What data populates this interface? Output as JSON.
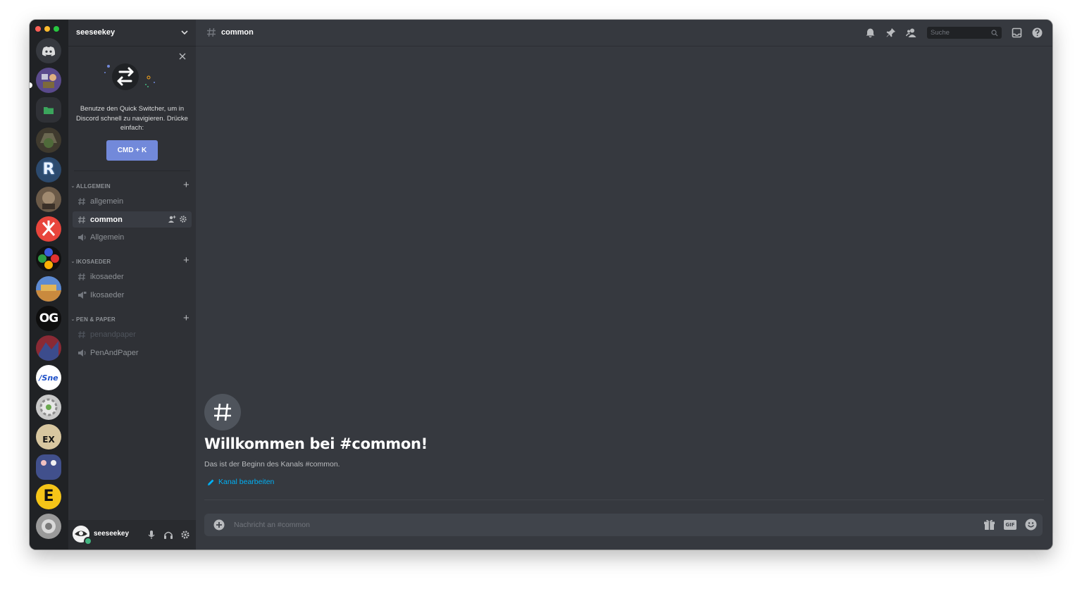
{
  "window": {
    "traffic_lights": [
      "#ff5f57",
      "#febc2e",
      "#28c840"
    ]
  },
  "servers": [
    {
      "name": "home",
      "label": ""
    },
    {
      "name": "server-1",
      "label": ""
    },
    {
      "name": "folder",
      "label": ""
    },
    {
      "name": "server-3",
      "label": ""
    },
    {
      "name": "server-4",
      "label": "R"
    },
    {
      "name": "server-5",
      "label": ""
    },
    {
      "name": "server-6",
      "label": ""
    },
    {
      "name": "server-7",
      "label": ""
    },
    {
      "name": "server-8",
      "label": ""
    },
    {
      "name": "server-9",
      "label": "OG"
    },
    {
      "name": "server-10",
      "label": ""
    },
    {
      "name": "server-11",
      "label": "/Sne"
    },
    {
      "name": "server-12",
      "label": ""
    },
    {
      "name": "server-13",
      "label": "EX"
    },
    {
      "name": "server-14",
      "label": ""
    },
    {
      "name": "server-15",
      "label": "E"
    },
    {
      "name": "server-16",
      "label": ""
    }
  ],
  "guild": {
    "name": "seeseekey"
  },
  "quick_switcher": {
    "text": "Benutze den Quick Switcher, um in Discord schnell zu navigieren. Drücke einfach:",
    "button": "CMD + K"
  },
  "categories": [
    {
      "name": "ALLGEMEIN",
      "channels": [
        {
          "type": "text",
          "name": "allgemein",
          "state": "normal"
        },
        {
          "type": "text",
          "name": "common",
          "state": "active"
        },
        {
          "type": "voice",
          "name": "Allgemein",
          "state": "normal"
        }
      ]
    },
    {
      "name": "IKOSAEDER",
      "channels": [
        {
          "type": "text",
          "name": "ikosaeder",
          "state": "normal"
        },
        {
          "type": "voice",
          "name": "Ikosaeder",
          "state": "normal"
        }
      ]
    },
    {
      "name": "PEN & PAPER",
      "channels": [
        {
          "type": "text",
          "name": "penandpaper",
          "state": "muted"
        },
        {
          "type": "voice",
          "name": "PenAndPaper",
          "state": "normal"
        }
      ]
    }
  ],
  "user": {
    "name": "seeseekey",
    "status": "online"
  },
  "channel_header": {
    "name": "common",
    "search_placeholder": "Suche"
  },
  "welcome": {
    "title": "Willkommen bei #common!",
    "subtitle": "Das ist der Beginn des Kanals #common.",
    "edit_link": "Kanal bearbeiten"
  },
  "composer": {
    "placeholder": "Nachricht an #common",
    "gif_label": "GIF"
  },
  "colors": {
    "accent": "#7289da",
    "link": "#00b0f4",
    "online": "#43b581"
  }
}
